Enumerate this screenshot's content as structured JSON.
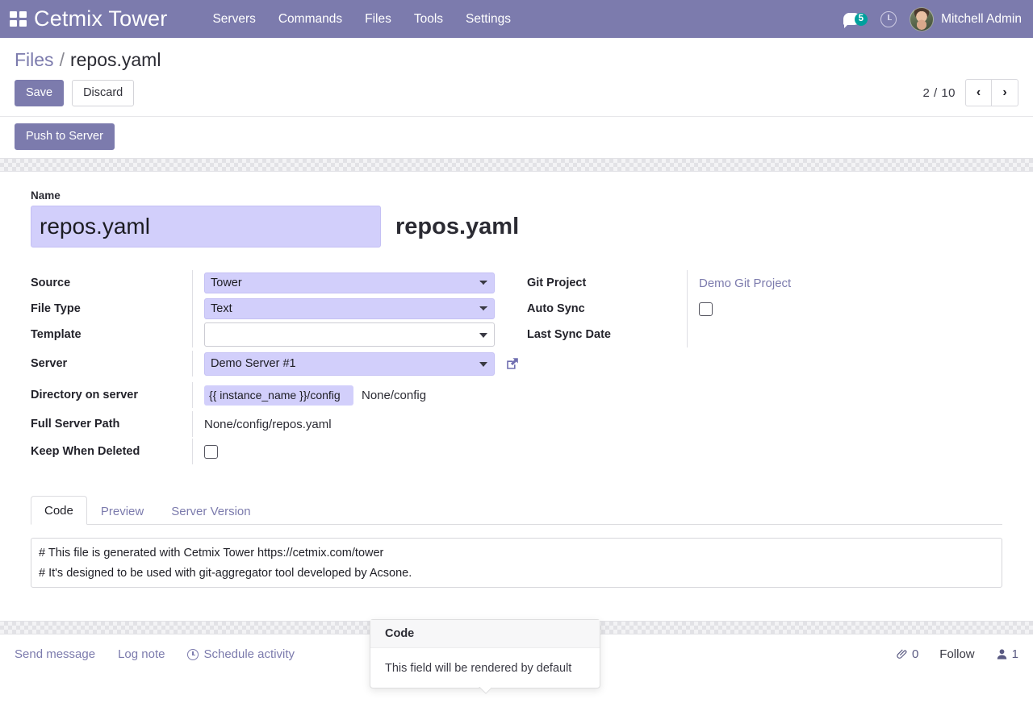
{
  "navbar": {
    "apps_icon": "apps-grid-icon",
    "brand": "Cetmix Tower",
    "menu": [
      "Servers",
      "Commands",
      "Files",
      "Tools",
      "Settings"
    ],
    "messages_icon": "messages-icon",
    "messages_count": "5",
    "activities_icon": "clock-icon",
    "user_name": "Mitchell Admin"
  },
  "breadcrumb": {
    "root": "Files",
    "separator": "/",
    "current": "repos.yaml"
  },
  "controlpanel": {
    "save_label": "Save",
    "discard_label": "Discard",
    "push_label": "Push to Server",
    "pager_count": "2 / 10",
    "prev_icon": "chevron-left-icon",
    "next_icon": "chevron-right-icon"
  },
  "form": {
    "name_label": "Name",
    "name_value": "repos.yaml",
    "title_echo": "repos.yaml",
    "left_fields": {
      "source_label": "Source",
      "source_value": "Tower",
      "source_options": [
        "Tower"
      ],
      "file_type_label": "File Type",
      "file_type_value": "Text",
      "file_type_options": [
        "Text"
      ],
      "template_label": "Template",
      "template_value": "",
      "template_placeholder": "",
      "server_label": "Server",
      "server_value": "Demo Server #1",
      "server_external_icon": "external-link-icon",
      "directory_label": "Directory on server",
      "directory_value": "{{ instance_name }}/config",
      "directory_resolved": "None/config",
      "full_path_label": "Full Server Path",
      "full_path_value": "None/config/repos.yaml",
      "keep_label": "Keep When Deleted",
      "keep_checked": false
    },
    "right_fields": {
      "git_project_label": "Git Project",
      "git_project_value": "Demo Git Project",
      "auto_sync_label": "Auto Sync",
      "auto_sync_checked": false,
      "last_sync_label": "Last Sync Date",
      "last_sync_value": ""
    }
  },
  "tooltip": {
    "title": "Code",
    "body": "This field will be rendered by default"
  },
  "notebook": {
    "tabs": [
      {
        "label": "Code",
        "active": true
      },
      {
        "label": "Preview",
        "active": false
      },
      {
        "label": "Server Version",
        "active": false
      }
    ],
    "code_value": "# This file is generated with Cetmix Tower https://cetmix.com/tower\n# It's designed to be used with git-aggregator tool developed by Acsone.\n# Documentation for git-aggregator https://github.com/acsone/git-aggregator"
  },
  "chatter": {
    "send_message": "Send message",
    "log_note": "Log note",
    "schedule_activity": "Schedule activity",
    "schedule_icon": "clock-icon",
    "attachment_icon": "paperclip-icon",
    "attachment_count": "0",
    "follow_label": "Follow",
    "followers_icon": "user-icon",
    "followers_count": "1"
  },
  "colors": {
    "brand_purple": "#7c7bad",
    "field_lavender": "#d2cffb",
    "badge_teal": "#00a09d"
  }
}
